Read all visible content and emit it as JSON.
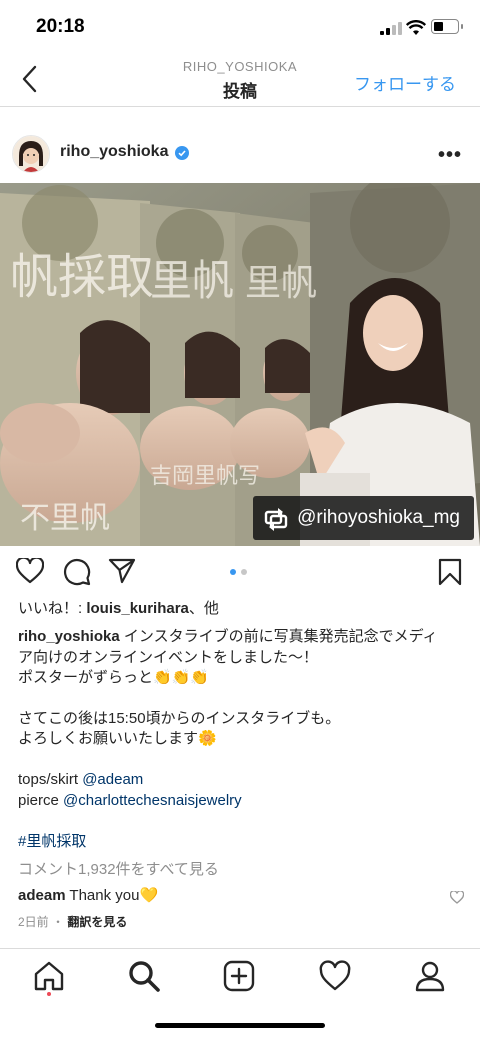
{
  "status_bar": {
    "time": "20:18"
  },
  "header": {
    "username": "RIHO_YOSHIOKA",
    "title": "投稿",
    "follow_label": "フォローする"
  },
  "post": {
    "username": "riho_yoshioka",
    "repost_handle": "@rihoyoshioka_mg",
    "likes_prefix": "いいね！: ",
    "likes_user": "louis_kurihara",
    "likes_suffix": "、他",
    "caption_user": "riho_yoshioka",
    "caption_lines": [
      " インスタライブの前に写真集発売記念でメディ",
      "ア向けのオンラインイベントをしました〜！",
      "ポスターがずらっと👏👏👏",
      "さてこの後は15:50頃からのインスタライブも。",
      "よろしくお願いいたします🌼"
    ],
    "credit1_label": "tops/skirt ",
    "credit1_link": "@adeam",
    "credit2_label": "pierce ",
    "credit2_link": "@charlottechesnaisjewelry",
    "hashtag": "#里帆採取",
    "view_comments": "コメント1,932件をすべて見る",
    "comment_user": "adeam",
    "comment_text": " Thank you💛",
    "time_ago": "2日前",
    "translate_sep": " ・ ",
    "translate_label": "翻訳を見る"
  },
  "colors": {
    "accent": "#3897f0",
    "verified": "#3897f0",
    "link": "#003569",
    "notif_dot": "#ed4956"
  },
  "icons": [
    "back-chevron-icon",
    "verified-badge-icon",
    "more-icon",
    "repost-icon",
    "heart-icon",
    "comment-icon",
    "share-icon",
    "bookmark-icon",
    "home-icon",
    "search-icon",
    "add-icon",
    "activity-icon",
    "profile-icon"
  ]
}
